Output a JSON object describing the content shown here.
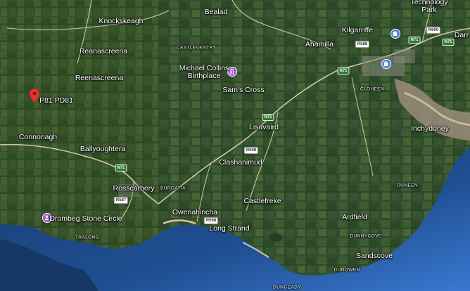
{
  "map": {
    "pin": {
      "label": "P81 PD81",
      "icon": "red-location-pin-icon"
    },
    "places": [
      {
        "id": "bealad",
        "label": "Bealad",
        "kind": "town"
      },
      {
        "id": "technology-park",
        "label": "Technology\nPark",
        "kind": "town"
      },
      {
        "id": "knockskeagh",
        "label": "Knockskeagh",
        "kind": "town"
      },
      {
        "id": "kilgarriffe",
        "label": "Kilgarriffe",
        "kind": "town"
      },
      {
        "id": "ahamilla",
        "label": "Ahamilla",
        "kind": "town"
      },
      {
        "id": "reanascreena",
        "label": "Reanascreena",
        "kind": "town"
      },
      {
        "id": "reenascreena",
        "label": "Reenascreena",
        "kind": "town"
      },
      {
        "id": "sams-cross",
        "label": "Sam's Cross",
        "kind": "town"
      },
      {
        "id": "lisavaird",
        "label": "Lisavaird",
        "kind": "town"
      },
      {
        "id": "inchydoney",
        "label": "Inchydoney",
        "kind": "town"
      },
      {
        "id": "connonagh",
        "label": "Connonagh",
        "kind": "town"
      },
      {
        "id": "ballyoughtera",
        "label": "Ballyoughtera",
        "kind": "town"
      },
      {
        "id": "clashanimud",
        "label": "Clashanimud",
        "kind": "town"
      },
      {
        "id": "rosscarbery",
        "label": "Rosscarbery",
        "kind": "town"
      },
      {
        "id": "castlefreke",
        "label": "Castlefreke",
        "kind": "town"
      },
      {
        "id": "owenahincha",
        "label": "Owenahincha",
        "kind": "town"
      },
      {
        "id": "long-strand",
        "label": "Long Strand",
        "kind": "town"
      },
      {
        "id": "ardfield",
        "label": "Ardfield",
        "kind": "town"
      },
      {
        "id": "sandscove",
        "label": "Sandscove",
        "kind": "town"
      },
      {
        "id": "darr",
        "label": "Darr",
        "kind": "town"
      },
      {
        "id": "castleventry",
        "label": "CASTLEVENTRY",
        "kind": "small"
      },
      {
        "id": "cloheen",
        "label": "CLOHEEN",
        "kind": "small"
      },
      {
        "id": "burgatia",
        "label": "BURGATIA",
        "kind": "small"
      },
      {
        "id": "duneen",
        "label": "DUNEEN",
        "kind": "small"
      },
      {
        "id": "tralong",
        "label": "TRALONG",
        "kind": "small"
      },
      {
        "id": "dunnycove",
        "label": "DUNNYCOVE",
        "kind": "small"
      },
      {
        "id": "dunowen",
        "label": "DUNOWEN",
        "kind": "small"
      },
      {
        "id": "dungeady",
        "label": "DUNGEADY",
        "kind": "small"
      }
    ],
    "pois": [
      {
        "id": "michael-collins",
        "label": "Michael Collins\nBirthplace",
        "icon": "museum-icon",
        "color": "#9b59d0"
      },
      {
        "id": "drombeg",
        "label": "Drombeg Stone Circle",
        "icon": "landmark-icon",
        "color": "#9b59d0"
      },
      {
        "id": "kilgarriffe-poi",
        "label": "",
        "icon": "church-icon",
        "color": "#4a7fe0"
      },
      {
        "id": "clonakilty-poi",
        "label": "",
        "icon": "building-icon",
        "color": "#4a7fe0"
      }
    ],
    "road_shields": [
      {
        "id": "n71-a",
        "label": "N71",
        "kind": "n"
      },
      {
        "id": "n71-b",
        "label": "N71",
        "kind": "n"
      },
      {
        "id": "n71-c",
        "label": "N71",
        "kind": "n"
      },
      {
        "id": "n71-d",
        "label": "N71",
        "kind": "n"
      },
      {
        "id": "n71-e",
        "label": "N71",
        "kind": "n"
      },
      {
        "id": "r598",
        "label": "R598",
        "kind": "r"
      },
      {
        "id": "r598-b",
        "label": "R598",
        "kind": "r"
      },
      {
        "id": "r587",
        "label": "R587",
        "kind": "r"
      },
      {
        "id": "r600",
        "label": "R600",
        "kind": "r"
      },
      {
        "id": "r588",
        "label": "R588",
        "kind": "r"
      }
    ],
    "colors": {
      "sea": "#1d4e8c",
      "land": "#3b5a32",
      "road": "#e8dfc0",
      "pin": "#e8332a",
      "poi_purple": "#9b59d0",
      "poi_blue": "#4a7fe0"
    }
  }
}
